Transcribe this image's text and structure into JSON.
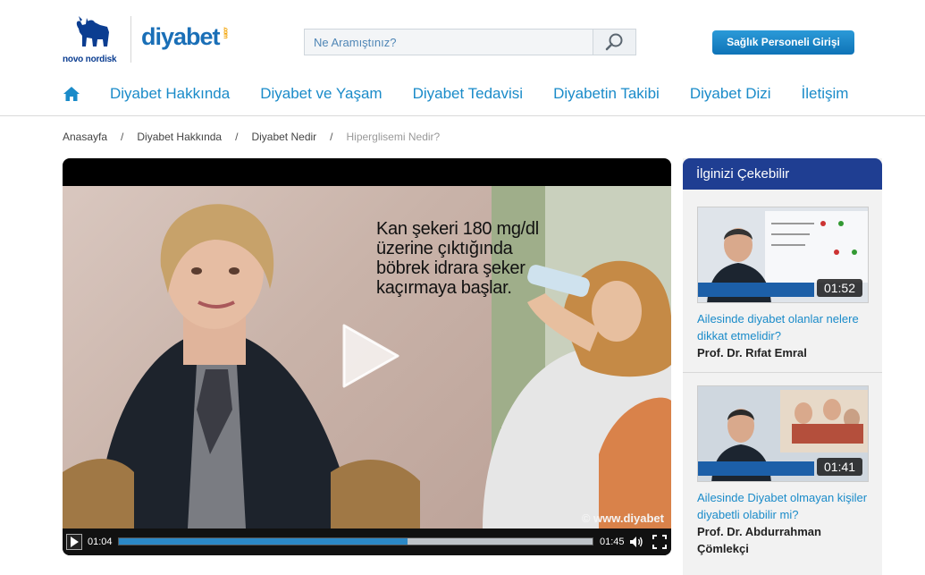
{
  "header": {
    "brand_left": "novo nordisk",
    "brand_right": "diyabet",
    "brand_right_suffix": ".com",
    "search": {
      "placeholder": "Ne Aramıştınız?"
    },
    "login_label": "Sağlık Personeli Girişi"
  },
  "nav": {
    "items": [
      {
        "label": "Diyabet Hakkında"
      },
      {
        "label": "Diyabet ve Yaşam"
      },
      {
        "label": "Diyabet Tedavisi"
      },
      {
        "label": "Diyabetin Takibi"
      },
      {
        "label": "Diyabet Dizi"
      },
      {
        "label": "İletişim"
      }
    ]
  },
  "breadcrumb": {
    "items": [
      "Anasayfa",
      "Diyabet Hakkında",
      "Diyabet Nedir",
      "Hiperglisemi Nedir?"
    ],
    "separator": "/"
  },
  "player": {
    "overlay_lines": [
      "Kan şekeri 180 mg/dl",
      "üzerine çıktığında",
      "böbrek idrara şeker",
      "kaçırmaya başlar."
    ],
    "watermark": "© www.diyabet",
    "current_time": "01:04",
    "duration": "01:45",
    "progress_fraction": 0.61
  },
  "sidebar": {
    "title": "İlginizi Çekebilir",
    "items": [
      {
        "duration": "01:52",
        "title": "Ailesinde diyabet olanlar nelere dikkat etmelidir?",
        "author": "Prof. Dr. Rıfat Emral"
      },
      {
        "duration": "01:41",
        "title": "Ailesinde Diyabet olmayan kişiler diyabetli olabilir mi?",
        "author": "Prof. Dr. Abdurrahman Çömlekçi"
      }
    ]
  },
  "colors": {
    "nav_link": "#1a8bc9",
    "sidebar_header": "#1f3e92",
    "login_button": "#0e73b7",
    "progress": "#2b88c6"
  }
}
